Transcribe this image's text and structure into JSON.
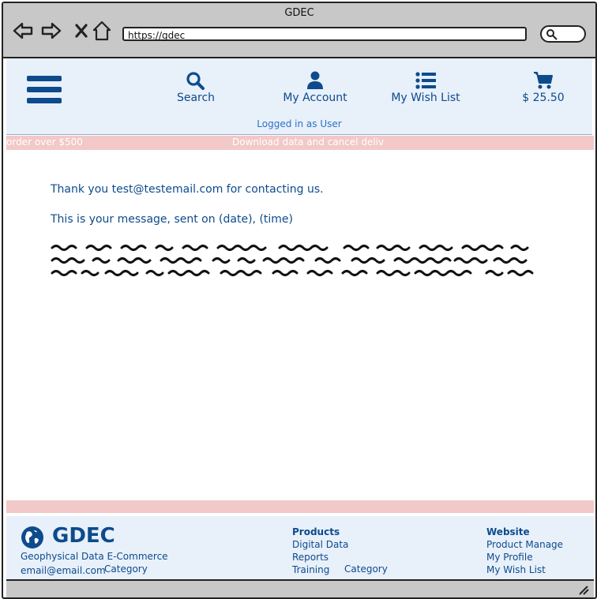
{
  "browser": {
    "title": "GDEC",
    "url": "https://gdec",
    "icons": [
      "back-icon",
      "forward-icon",
      "close-icon",
      "home-icon",
      "search-icon"
    ]
  },
  "header": {
    "nav": {
      "search": "Search",
      "account": "My Account",
      "wishlist": "My Wish List",
      "cart": "$ 25.50"
    },
    "status": "Logged in as User"
  },
  "marquee": {
    "left": "order over $500",
    "middle": "Download data and cancel deliv"
  },
  "content": {
    "thanks": "Thank you test@testemail.com for contacting us.",
    "sent": "This is your message, sent on (date), (time)"
  },
  "footer": {
    "brand": {
      "name": "GDEC",
      "subtitle": "Geophysical Data E-Commerce",
      "email": "email@email.com",
      "category": "Category"
    },
    "products": {
      "heading": "Products",
      "items": [
        "Digital Data",
        "Reports",
        "Training"
      ],
      "category": "Category"
    },
    "website": {
      "heading": "Website",
      "items": [
        "Product Manage",
        "My Profile",
        "My Wish List"
      ]
    }
  },
  "colors": {
    "brand": "#0d4b8c",
    "header_bg": "#e8f0fa",
    "band": "#f2c8c8",
    "chrome": "#c8c8c8"
  }
}
